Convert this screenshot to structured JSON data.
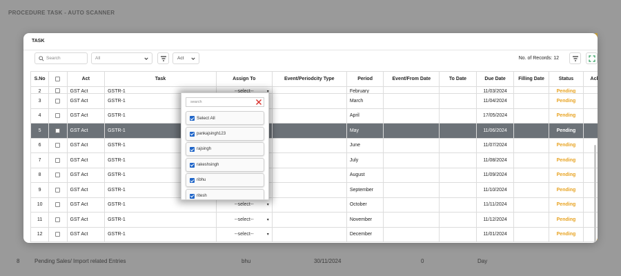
{
  "background": {
    "title": "PROCEDURE TASK - AUTO SCANNER",
    "row": {
      "num": "8",
      "task": "Pending Sales/ Import related Entries",
      "assign": "bhu",
      "date": "30/11/2024",
      "ack": "0",
      "freq": "Day"
    }
  },
  "modal": {
    "title": "TASK",
    "search_placeholder": "Search",
    "filter_all_value": "All",
    "act_value": "Act",
    "records_label": "No. of Records: 12",
    "columns": [
      "S.No",
      "",
      "Act",
      "Task",
      "Assign To",
      "Event/Periodcity Type",
      "Period",
      "Event/From Date",
      "To Date",
      "Due Date",
      "Filling Date",
      "Status",
      "Ack File Up"
    ],
    "rows": [
      {
        "sno": "2",
        "act": "GST Act",
        "task": "GSTR-1",
        "assign": "--select--",
        "period": "February",
        "due": "11/03/2024",
        "status": "Pending"
      },
      {
        "sno": "3",
        "act": "GST Act",
        "task": "GSTR-1",
        "assign": "",
        "period": "March",
        "due": "11/04/2024",
        "status": "Pending"
      },
      {
        "sno": "4",
        "act": "GST Act",
        "task": "GSTR-1",
        "assign": "",
        "period": "April",
        "due": "17/05/2024",
        "status": "Pending"
      },
      {
        "sno": "5",
        "act": "GST Act",
        "task": "GSTR-1",
        "assign": "",
        "period": "May",
        "due": "11/06/2024",
        "status": "Pending",
        "active": true
      },
      {
        "sno": "6",
        "act": "GST Act",
        "task": "GSTR-1",
        "assign": "",
        "period": "June",
        "due": "11/07/2024",
        "status": "Pending"
      },
      {
        "sno": "7",
        "act": "GST Act",
        "task": "GSTR-1",
        "assign": "",
        "period": "July",
        "due": "11/08/2024",
        "status": "Pending"
      },
      {
        "sno": "8",
        "act": "GST Act",
        "task": "GSTR-1",
        "assign": "",
        "period": "August",
        "due": "11/09/2024",
        "status": "Pending"
      },
      {
        "sno": "9",
        "act": "GST Act",
        "task": "GSTR-1",
        "assign": "",
        "period": "September",
        "due": "11/10/2024",
        "status": "Pending"
      },
      {
        "sno": "10",
        "act": "GST Act",
        "task": "GSTR-1",
        "assign": "--select--",
        "period": "October",
        "due": "11/11/2024",
        "status": "Pending"
      },
      {
        "sno": "11",
        "act": "GST Act",
        "task": "GSTR-1",
        "assign": "--select--",
        "period": "November",
        "due": "11/12/2024",
        "status": "Pending"
      },
      {
        "sno": "12",
        "act": "GST Act",
        "task": "GSTR-1",
        "assign": "--select--",
        "period": "December",
        "due": "11/01/2024",
        "status": "Pending"
      }
    ]
  },
  "popup": {
    "search_placeholder": "search",
    "items": [
      {
        "label": "Select All",
        "checked": true
      },
      {
        "label": "pankajsingh123",
        "checked": true
      },
      {
        "label": "rajsingh",
        "checked": true
      },
      {
        "label": "rakeshsingh",
        "checked": true
      },
      {
        "label": "ribhu",
        "checked": true
      },
      {
        "label": "ritesh",
        "checked": true
      }
    ]
  },
  "colors": {
    "accent": "#e8a321",
    "active_row": "#6c7278",
    "checkbox": "#1f65c8",
    "close": "#d9302c"
  }
}
